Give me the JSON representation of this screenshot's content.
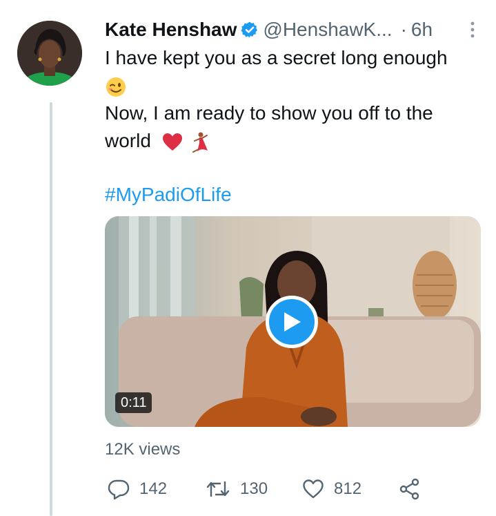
{
  "tweet": {
    "author_name": "Kate Henshaw",
    "handle": "@HenshawK...",
    "separator": "·",
    "time": "6h",
    "text_line_1": "I have kept you as a secret long enough",
    "text_line_2": "Now, I am ready to show you off to the",
    "text_line_3": "world",
    "hashtag": "#MyPadiOfLife",
    "views": "12K views"
  },
  "video": {
    "duration": "0:11"
  },
  "actions": {
    "replies": "142",
    "retweets": "130",
    "likes": "812"
  },
  "icons": {
    "verified": "verified-badge-icon",
    "more": "more-vertical-icon",
    "reply": "reply-icon",
    "retweet": "retweet-icon",
    "like": "heart-icon",
    "share": "share-icon",
    "play": "play-icon"
  },
  "colors": {
    "accent": "#1d9bf0",
    "secondary_text": "#536471",
    "primary_text": "#0f1419",
    "thread_line": "#cfd9de"
  }
}
